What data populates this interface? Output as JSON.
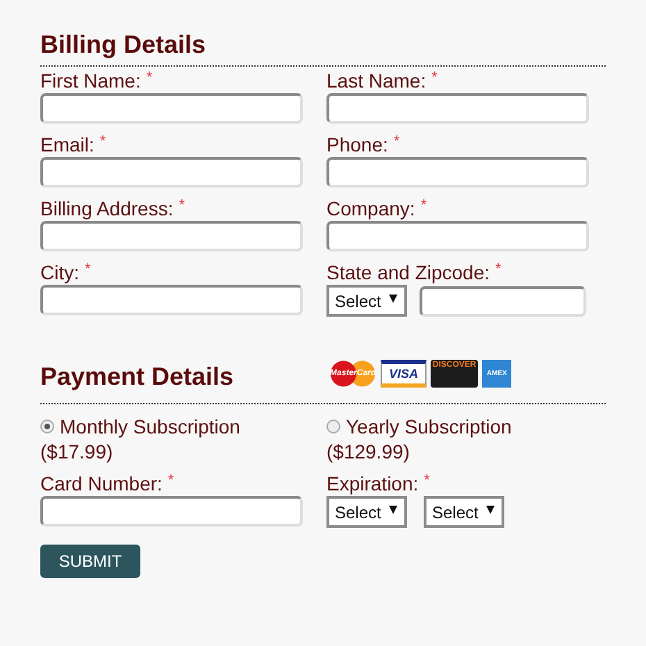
{
  "billing": {
    "title": "Billing Details",
    "fields": [
      {
        "label": "First Name:",
        "required_mark": "*",
        "kind": "text"
      },
      {
        "label": "Last Name:",
        "required_mark": "*",
        "kind": "text"
      },
      {
        "label": "Email:",
        "required_mark": "*",
        "kind": "text"
      },
      {
        "label": "Phone:",
        "required_mark": "*",
        "kind": "text"
      },
      {
        "label": "Billing Address:",
        "required_mark": "*",
        "kind": "text"
      },
      {
        "label": "Company:",
        "required_mark": "*",
        "kind": "text"
      },
      {
        "label": "City:",
        "required_mark": "*",
        "kind": "text"
      },
      {
        "label": "State and Zipcode:",
        "required_mark": "*",
        "kind": "select-text",
        "selects": [
          "Select"
        ]
      }
    ]
  },
  "payment": {
    "title": "Payment Details",
    "cards": [
      {
        "kind": "mastercard",
        "text": "MasterCard"
      },
      {
        "kind": "visa",
        "text": "VISA"
      },
      {
        "kind": "discover",
        "text": "DISCOVER"
      },
      {
        "kind": "amex",
        "text": "AMEX"
      }
    ],
    "plans": [
      {
        "label": "Monthly Subscription",
        "price": "($17.99)",
        "selected": true
      },
      {
        "label": "Yearly Subscription",
        "price": "($129.99)",
        "selected": false
      }
    ],
    "fields": [
      {
        "label": "Card Number:",
        "required_mark": "*",
        "kind": "text"
      },
      {
        "label": "Expiration:",
        "required_mark": "*",
        "kind": "selects",
        "selects": [
          "Select",
          "Select"
        ]
      }
    ]
  },
  "submit": "SUBMIT"
}
